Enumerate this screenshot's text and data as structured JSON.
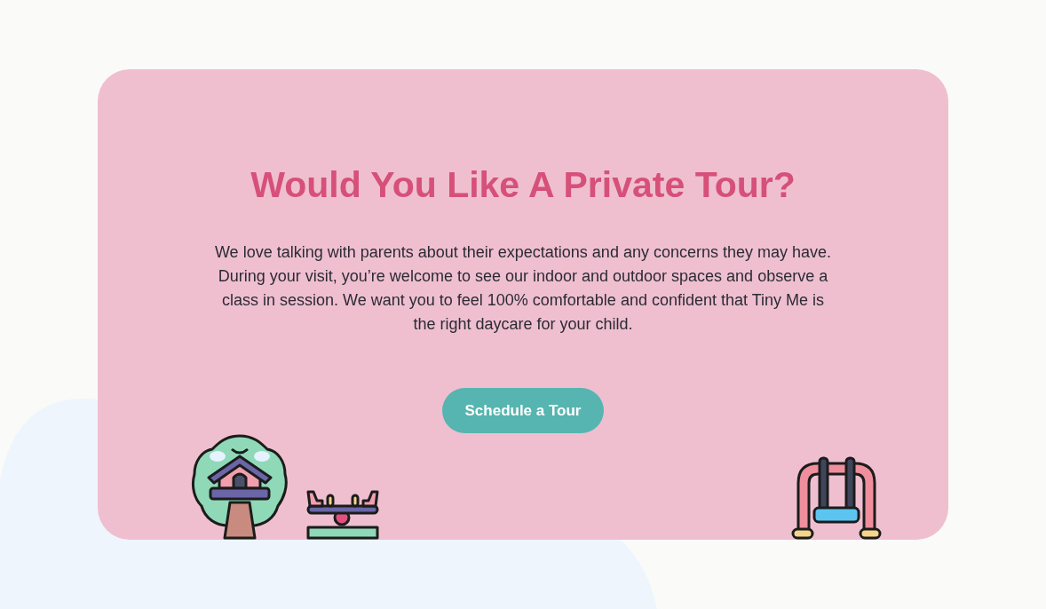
{
  "tour_card": {
    "title": "Would You Like A Private Tour?",
    "description": "We love talking with parents about their expectations and any concerns they may have. During your visit, you’re welcome to see our indoor and outdoor spaces and observe a class in session. We want you to feel 100% comfortable and confident that Tiny Me is the right daycare for your child.",
    "button": "Schedule a Tour"
  }
}
